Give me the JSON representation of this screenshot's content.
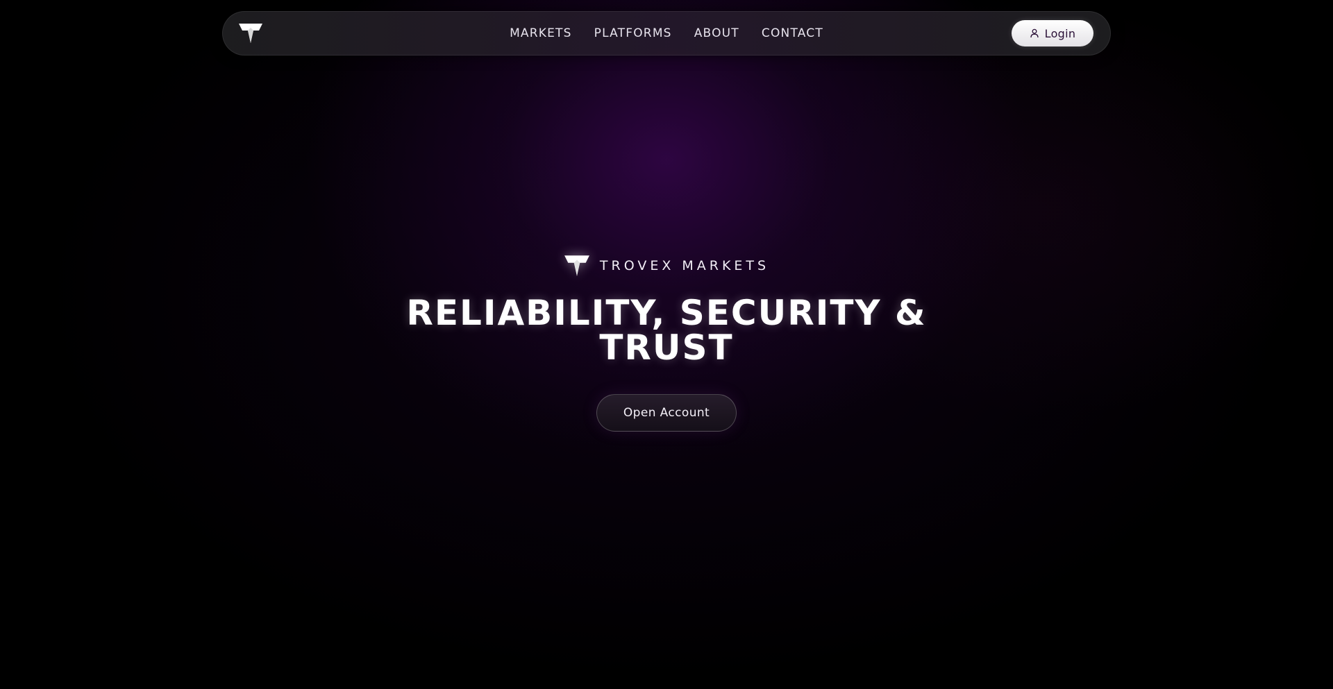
{
  "navbar": {
    "logo_icon": "trovex-t-logo-icon",
    "links": [
      {
        "label": "MARKETS"
      },
      {
        "label": "PLATFORMS"
      },
      {
        "label": "ABOUT"
      },
      {
        "label": "CONTACT"
      }
    ],
    "login": {
      "label": "Login",
      "icon": "user-icon"
    }
  },
  "hero": {
    "brand_icon": "trovex-t-logo-icon",
    "brand_name": "TROVEX MARKETS",
    "title_line_1": "RELIABILITY, SECURITY &",
    "title_line_2": "TRUST",
    "cta_label": "Open Account"
  },
  "colors": {
    "background": "#000000",
    "glow_purple": "#34064a",
    "navbar_bg": "#1e1e20",
    "text_primary": "#ffffff",
    "login_text": "#2a1036",
    "login_bg": "#ffffff"
  }
}
